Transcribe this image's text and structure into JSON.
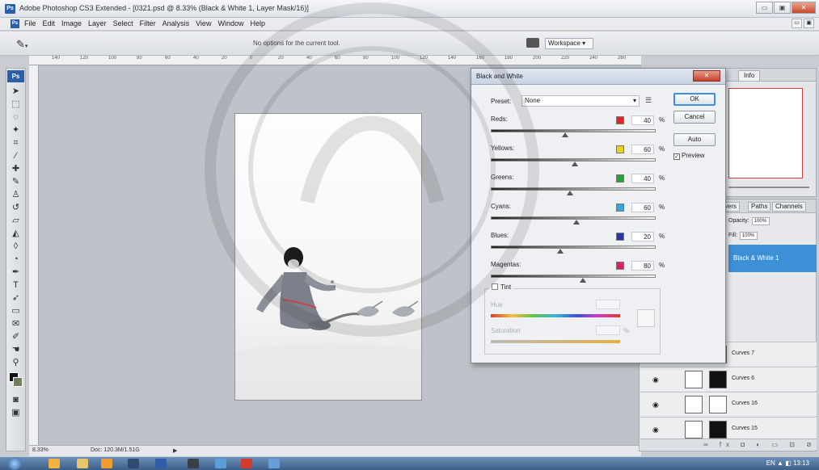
{
  "window": {
    "title": "Adobe Photoshop CS3 Extended - [0321.psd @ 8.33% (Black & White 1, Layer Mask/16)]",
    "app_badge": "Ps",
    "min": "▭",
    "restore": "▣",
    "close": "✕"
  },
  "menu": {
    "items": [
      "File",
      "Edit",
      "Image",
      "Layer",
      "Select",
      "Filter",
      "Analysis",
      "View",
      "Window",
      "Help"
    ]
  },
  "options_bar": {
    "tool_icon": "eyedropper-icon",
    "message": "No options for the current tool.",
    "workspace_label": "Workspace ▾"
  },
  "ruler": {
    "ticks": [
      "140",
      "120",
      "100",
      "80",
      "60",
      "40",
      "20",
      "0",
      "20",
      "40",
      "60",
      "80",
      "100",
      "120",
      "140",
      "160",
      "180",
      "200",
      "220",
      "240",
      "260"
    ]
  },
  "status": {
    "zoom": "8.33%",
    "doc": "Doc: 120.3M/1.51G"
  },
  "dialog": {
    "title": "Black and White",
    "preset_label": "Preset:",
    "preset_value": "None",
    "ok": "OK",
    "cancel": "Cancel",
    "auto": "Auto",
    "preview_label": "Preview",
    "preview_checked": true,
    "sliders": [
      {
        "label": "Reds:",
        "value": "40",
        "unit": "%",
        "color": "#e02424",
        "level": 0.45
      },
      {
        "label": "Yellows:",
        "value": "60",
        "unit": "%",
        "color": "#e8d21c",
        "level": 0.51
      },
      {
        "label": "Greens:",
        "value": "40",
        "unit": "%",
        "color": "#2a9e3a",
        "level": 0.48
      },
      {
        "label": "Cyans:",
        "value": "60",
        "unit": "%",
        "color": "#2fa6dc",
        "level": 0.52
      },
      {
        "label": "Blues:",
        "value": "20",
        "unit": "%",
        "color": "#2436a8",
        "level": 0.42
      },
      {
        "label": "Magentas:",
        "value": "80",
        "unit": "%",
        "color": "#e01e5a",
        "level": 0.56
      }
    ],
    "tint_label": "Tint",
    "hue_label": "Hue",
    "saturation_label": "Saturation",
    "saturation_unit": "%"
  },
  "panels": {
    "info_tab": "Info",
    "layer_tabs": [
      "Layers",
      "Paths",
      "Channels"
    ],
    "opacity_label": "Opacity:",
    "opacity_value": "100%",
    "fill_label": "Fill:",
    "fill_value": "100%",
    "selected_layer": "Black & White 1",
    "layers": [
      "Curves 7",
      "Curves 6",
      "Curves 16",
      "Curves 15"
    ],
    "footer_icons": "∞ fx ◘ ◐ ▭ ⊡ ⊘"
  },
  "taskbar": {
    "tray": "EN ▲ ◧ 13:13"
  }
}
